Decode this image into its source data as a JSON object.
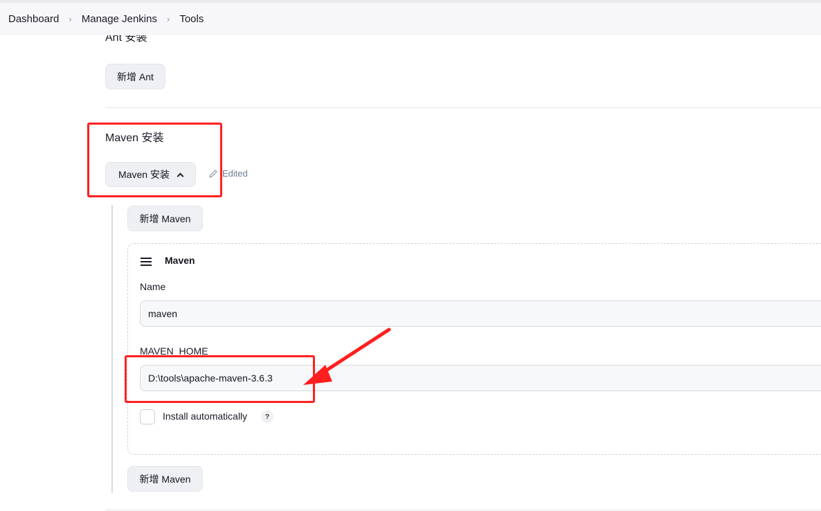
{
  "breadcrumb": {
    "items": [
      "Dashboard",
      "Manage Jenkins",
      "Tools"
    ],
    "separator": "›"
  },
  "ant": {
    "section_title": "Ant 安装",
    "add_button": "新增 Ant"
  },
  "maven": {
    "section_title": "Maven 安装",
    "toggle_button": "Maven 安装",
    "edited_label": "Edited",
    "add_button_top": "新增 Maven",
    "add_button_bottom": "新增 Maven",
    "card": {
      "title": "Maven",
      "name_label": "Name",
      "name_value": "maven",
      "home_label": "MAVEN_HOME",
      "home_value": "D:\\tools\\apache-maven-3.6.3",
      "install_auto_label": "Install automatically",
      "install_auto_checked": false,
      "help": "?"
    }
  },
  "colors": {
    "annotation": "#ff1f1f",
    "button_bg": "#eef0f3",
    "edited_text": "#6b7b95"
  }
}
